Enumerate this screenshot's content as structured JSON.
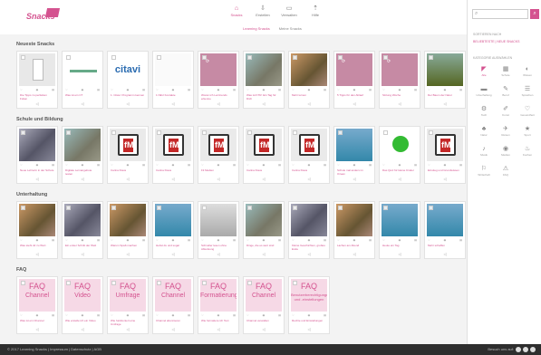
{
  "logo": {
    "sub": "",
    "main": "Snacks"
  },
  "nav": [
    {
      "label": "Snacks",
      "icon": "⌂",
      "active": true
    },
    {
      "label": "Erstellen",
      "icon": "⇩",
      "active": false
    },
    {
      "label": "Verwalten",
      "icon": "▭",
      "active": false
    },
    {
      "label": "Hilfe",
      "icon": "⇡",
      "active": false
    }
  ],
  "subtabs": [
    "Learning Snacks",
    "Meine Snacks"
  ],
  "sections": [
    {
      "title": "Neueste Snacks",
      "cards": [
        {
          "thumb": "doc",
          "title": "Die Tipps zu perfekten Folien"
        },
        {
          "thumb": "line",
          "title": "Was ist ein CT"
        },
        {
          "thumb": "citavi",
          "title": "1. Citavi: Programm kennen",
          "text": "citavi"
        },
        {
          "thumb": "white",
          "title": "1 NEU Kontakte"
        },
        {
          "thumb": "pink",
          "title": "Woran ich Lerntrends erkenne"
        },
        {
          "thumb": "photo",
          "title": "Was ist KTR: Ein Tag für Dich"
        },
        {
          "thumb": "photo2",
          "title": "Mehr lernen"
        },
        {
          "thumb": "pink",
          "title": "5 Tipps für den Ablauf"
        },
        {
          "thumb": "pink",
          "title": "Sitzung Woche"
        },
        {
          "thumb": "tree",
          "title": "Der Baum der Natur"
        }
      ]
    },
    {
      "title": "Schule und Bildung",
      "cards": [
        {
          "thumb": "photo3",
          "title": "Neue Lehrerin in der Schule"
        },
        {
          "thumb": "photo",
          "title": "Digitale Lernangebote testen"
        },
        {
          "thumb": "fm",
          "title": "Carina Klaus",
          "text": "fM"
        },
        {
          "thumb": "fm",
          "title": "Carina Klaus",
          "text": "fM"
        },
        {
          "thumb": "fm",
          "title": "Fit Medien",
          "text": "fM"
        },
        {
          "thumb": "fm",
          "title": "Carina Klaus",
          "text": "fM"
        },
        {
          "thumb": "fm",
          "title": "Carina Klaus",
          "text": "fM"
        },
        {
          "thumb": "sea",
          "title": "Schule mal anders im Ozean"
        },
        {
          "thumb": "green",
          "title": "Das Quiz für kleine Kinder"
        },
        {
          "thumb": "fm",
          "title": "Einstieg und Grundwissen",
          "text": "fM"
        }
      ]
    },
    {
      "title": "Unterhaltung",
      "cards": [
        {
          "thumb": "photo2",
          "title": "Was steht dir zu Wort"
        },
        {
          "thumb": "photo3",
          "title": "Ein erster Schritt der Welt"
        },
        {
          "thumb": "photo2",
          "title": "Warum Spaß machen"
        },
        {
          "thumb": "sea",
          "title": "Hebst du und sogar"
        },
        {
          "thumb": "beige",
          "title": "Schneller lesen ohne Ablenkung"
        },
        {
          "thumb": "photo",
          "title": "Dinge, die es wert sind"
        },
        {
          "thumb": "photo3",
          "title": "Kleine Geschichten, großes Ende"
        },
        {
          "thumb": "photo2",
          "title": "Lachen am Abend"
        },
        {
          "thumb": "sea",
          "title": "Heute ein Tag"
        },
        {
          "thumb": "sea",
          "title": "Mehr schaffen"
        }
      ]
    },
    {
      "title": "FAQ",
      "cards": [
        {
          "thumb": "faq",
          "title": "Was ist ein Channel",
          "faq": "FAQ",
          "label": "Channel"
        },
        {
          "thumb": "faq",
          "title": "Wie erstelle ich ein Video",
          "faq": "FAQ",
          "label": "Video"
        },
        {
          "thumb": "faq",
          "title": "Wie funktioniert eine Umfrage",
          "faq": "FAQ",
          "label": "Umfrage"
        },
        {
          "thumb": "faq",
          "title": "Channel abonnieren",
          "faq": "FAQ",
          "label": "Channel"
        },
        {
          "thumb": "faq",
          "title": "Wie formatiere ich Text",
          "faq": "FAQ",
          "label": "Formatierung"
        },
        {
          "thumb": "faq",
          "title": "Channel verwalten",
          "faq": "FAQ",
          "label": "Channel"
        },
        {
          "thumb": "faq",
          "title": "Rechte und Einstellungen",
          "faq": "FAQ",
          "label": "Benutzerberechtigungen und -einstellungen",
          "small": true
        }
      ]
    }
  ],
  "sidebar": {
    "search_placeholder": "",
    "search_btn": "⌕",
    "head1": "SORTIEREN NACH",
    "links": "BELIEBTESTE | NEUE SNACKS",
    "head2": "KATEGORIE AUSWÄHLEN",
    "categories": [
      {
        "label": "Alle",
        "icon": "◤",
        "active": true
      },
      {
        "label": "Schule",
        "icon": "▦"
      },
      {
        "label": "Wissen",
        "icon": "◐"
      },
      {
        "label": "Unterhaltung",
        "icon": "▬"
      },
      {
        "label": "Beruf",
        "icon": "✎"
      },
      {
        "label": "Sprachen",
        "icon": "☰"
      },
      {
        "label": "Tech",
        "icon": "⚙"
      },
      {
        "label": "Kunst",
        "icon": "✐"
      },
      {
        "label": "Gesundheit",
        "icon": "♡"
      },
      {
        "label": "Natur",
        "icon": "♣"
      },
      {
        "label": "Reisen",
        "icon": "✈"
      },
      {
        "label": "Sport",
        "icon": "★"
      },
      {
        "label": "Musik",
        "icon": "♪"
      },
      {
        "label": "Medien",
        "icon": "◉"
      },
      {
        "label": "Kochen",
        "icon": "♨"
      },
      {
        "label": "Wirtschaft",
        "icon": "⚐"
      },
      {
        "label": "FAQ",
        "icon": "⚠"
      }
    ]
  },
  "footer": {
    "links": "© 2017 Learning Snacks  |  Impressum  |  Datenschutz  |  AGB",
    "right": "Besuch uns auf:"
  },
  "colors": {
    "accent": "#d4528f",
    "footer": "#2e2e2e"
  }
}
